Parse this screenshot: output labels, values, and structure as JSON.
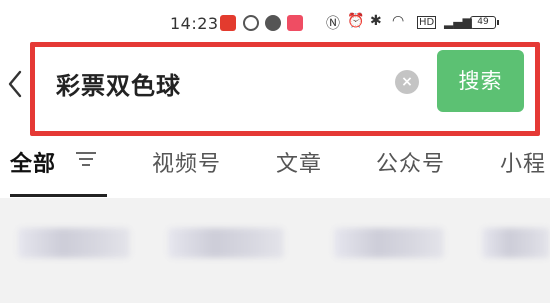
{
  "status_bar": {
    "time": "14:23",
    "battery": "49"
  },
  "search": {
    "query": "彩票双色球",
    "button_label": "搜索"
  },
  "tabs": [
    {
      "label": "全部",
      "active": true
    },
    {
      "label": "视频号",
      "active": false
    },
    {
      "label": "文章",
      "active": false
    },
    {
      "label": "公众号",
      "active": false
    },
    {
      "label": "小程",
      "active": false
    }
  ],
  "colors": {
    "accent_green": "#5cc173",
    "highlight_red": "#e53935"
  }
}
